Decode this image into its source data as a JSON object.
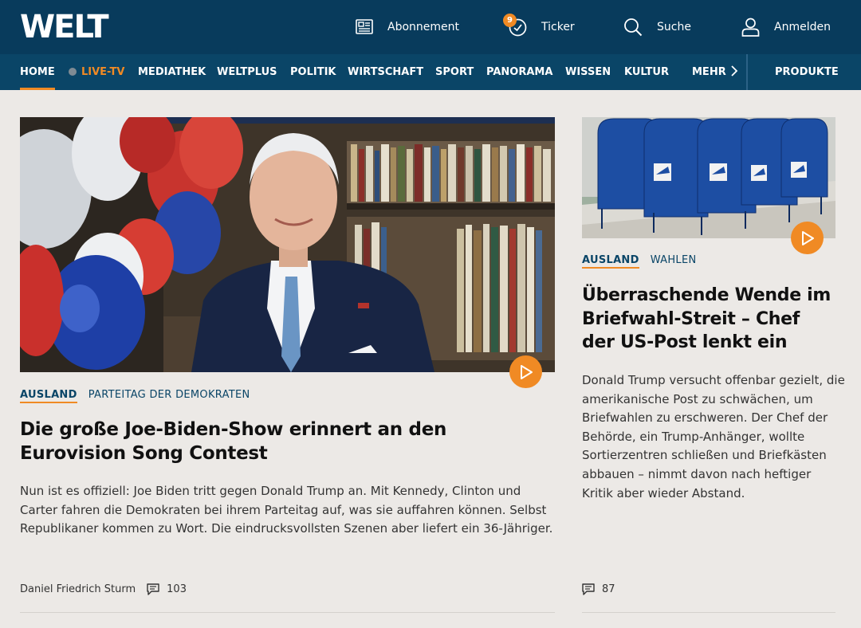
{
  "header": {
    "logo": "WELT",
    "tools": {
      "subscription": "Abonnement",
      "ticker": "Ticker",
      "ticker_badge": "9",
      "search": "Suche",
      "login": "Anmelden"
    }
  },
  "nav": {
    "home": "HOME",
    "live_tv": "LIVE-TV",
    "mediathek": "MEDIATHEK",
    "weltplus": "WELTPLUS",
    "politik": "POLITIK",
    "wirtschaft": "WIRTSCHAFT",
    "sport": "SPORT",
    "panorama": "PANORAMA",
    "wissen": "WISSEN",
    "kultur": "KULTUR",
    "mehr": "MEHR",
    "produkte": "PRODUKTE"
  },
  "main_article": {
    "kicker": "AUSLAND",
    "topic": "PARTEITAG DER DEMOKRATEN",
    "headline": "Die große Joe-Biden-Show erinnert an den Eurovision Song Contest",
    "teaser": "Nun ist es offiziell: Joe Biden tritt gegen Donald Trump an. Mit Kennedy, Clinton und Carter fahren die Demokraten bei ihrem Parteitag auf, was sie auffahren können. Selbst Republikaner kommen zu Wort. Die eindrucksvollsten Szenen aber liefert ein 36-Jähriger.",
    "author": "Daniel Friedrich Sturm",
    "comments": "103"
  },
  "side_article": {
    "kicker": "AUSLAND",
    "topic": "WAHLEN",
    "headline": "Überraschende Wende im Briefwahl-Streit – Chef der US-Post lenkt ein",
    "teaser": "Donald Trump versucht offenbar gezielt, die amerikanische Post zu schwächen, um Briefwahlen zu erschweren. Der Chef der Behörde, ein Trump-Anhänger, wollte Sortierzentren schließen und Briefkästen abbauen – nimmt davon nach heftiger Kritik aber wieder Abstand.",
    "comments": "87"
  },
  "colors": {
    "header_bg": "#083b5c",
    "nav_bg": "#0a4567",
    "accent": "#f08a24",
    "page_bg": "#ece9e6"
  }
}
